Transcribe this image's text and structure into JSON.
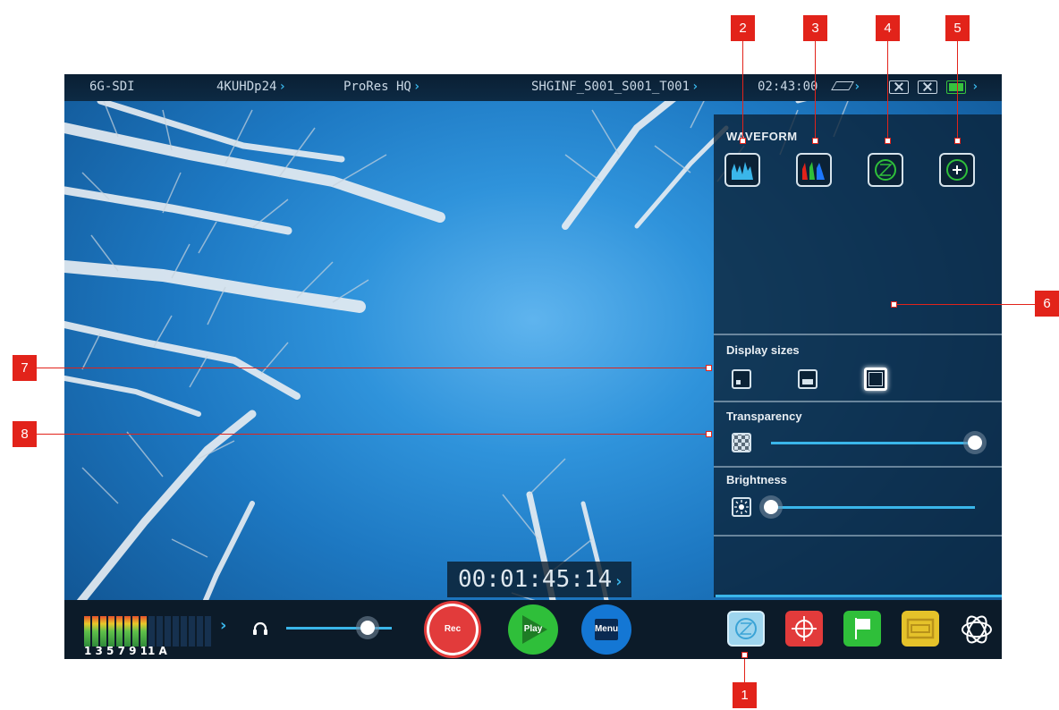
{
  "status_bar": {
    "input": "6G-SDI",
    "format": "4KUHDp24",
    "codec": "ProRes HQ",
    "clip_name": "SHGINF_S001_S001_T001",
    "time_remaining": "02:43:00"
  },
  "panel": {
    "waveform_title": "WAVEFORM",
    "display_sizes_label": "Display sizes",
    "transparency_label": "Transparency",
    "transparency_value": 1.0,
    "brightness_label": "Brightness",
    "brightness_value": 0.0
  },
  "timecode": "00:01:45:14",
  "bottom_bar": {
    "meter_labels": "1  3  5  7  9  11  A",
    "headphone_volume": 0.77,
    "rec_label": "Rec",
    "play_label": "Play",
    "menu_label": "Menu"
  },
  "callouts": [
    "1",
    "2",
    "3",
    "4",
    "5",
    "6",
    "7",
    "8"
  ],
  "colors": {
    "accent_blue": "#3ab6ea",
    "rec_red": "#e23b3b",
    "play_green": "#2fbf3a",
    "menu_blue": "#1477d4",
    "callout_red": "#e2231a"
  },
  "icons": {
    "waveform_luma": "waveform-luma-icon",
    "waveform_rgb": "rgb-parade-icon",
    "vectorscope": "vectorscope-icon",
    "zoom_vectorscope": "vectorscope-zoom-icon",
    "headphones": "headphones-icon",
    "scopes_tool": "scopes-icon",
    "focus_tool": "crosshair-icon",
    "tag_tool": "flag-icon",
    "frame_tool": "frame-guides-icon",
    "logo": "atomos-logo-icon"
  }
}
